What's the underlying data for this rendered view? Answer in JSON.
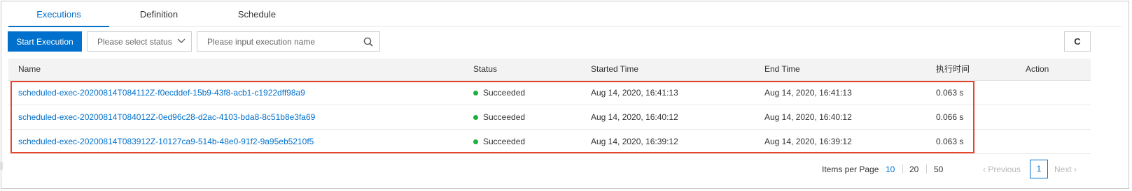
{
  "tabs": [
    {
      "label": "Executions"
    },
    {
      "label": "Definition"
    },
    {
      "label": "Schedule"
    }
  ],
  "toolbar": {
    "start_label": "Start Execution",
    "status_placeholder": "Please select status",
    "search_placeholder": "Please input execution name",
    "refresh_icon": "C"
  },
  "table": {
    "columns": [
      "Name",
      "Status",
      "Started Time",
      "End Time",
      "执行时间",
      "Action"
    ],
    "rows": [
      {
        "name": "scheduled-exec-20200814T084112Z-f0ecddef-15b9-43f8-acb1-c1922dff98a9",
        "status": "Succeeded",
        "started": "Aug 14, 2020, 16:41:13",
        "ended": "Aug 14, 2020, 16:41:13",
        "duration": "0.063 s"
      },
      {
        "name": "scheduled-exec-20200814T084012Z-0ed96c28-d2ac-4103-bda8-8c51b8e3fa69",
        "status": "Succeeded",
        "started": "Aug 14, 2020, 16:40:12",
        "ended": "Aug 14, 2020, 16:40:12",
        "duration": "0.066 s"
      },
      {
        "name": "scheduled-exec-20200814T083912Z-10127ca9-514b-48e0-91f2-9a95eb5210f5",
        "status": "Succeeded",
        "started": "Aug 14, 2020, 16:39:12",
        "ended": "Aug 14, 2020, 16:39:12",
        "duration": "0.063 s"
      }
    ]
  },
  "pagination": {
    "items_per_page_label": "Items per Page",
    "sizes": [
      "10",
      "20",
      "50"
    ],
    "previous_label": "Previous",
    "current_page": "1",
    "next_label": "Next"
  },
  "colors": {
    "accent": "#0070cc",
    "success": "#1cb03c",
    "highlight": "#e9442a"
  }
}
